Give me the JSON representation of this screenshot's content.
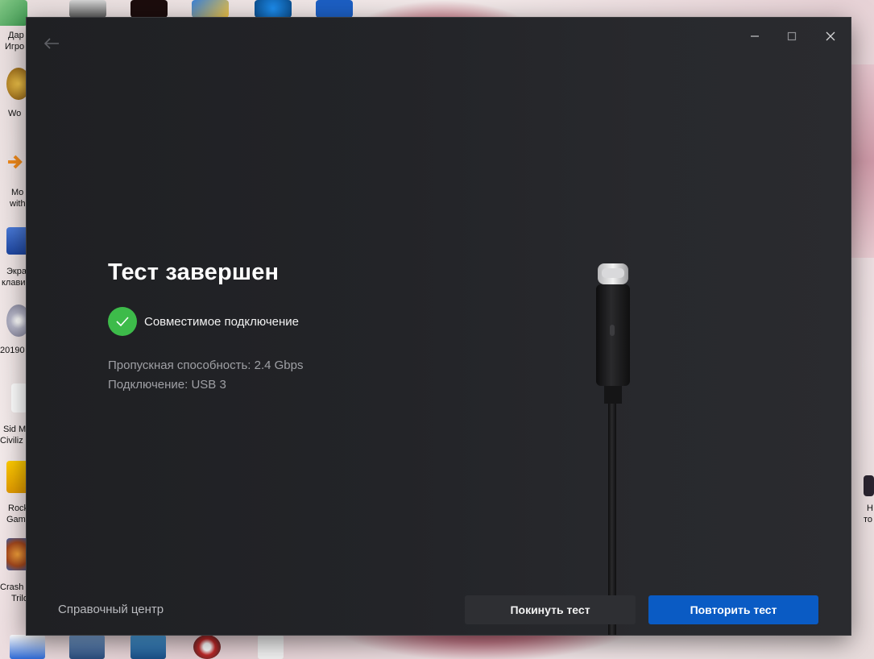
{
  "window": {
    "title": "Тест завершен",
    "status": "Совместимое подключение",
    "throughput": "Пропускная способность: 2.4 Gbps",
    "connection": "Подключение: USB 3",
    "help_link": "Справочный центр",
    "leave_button": "Покинуть тест",
    "retry_button": "Повторить тест"
  },
  "desktop": {
    "labels": [
      "Дар",
      "Игро",
      "Wo",
      "Mo",
      "with",
      "Экра",
      "клави",
      "20190",
      "Sid M",
      "Civiliz",
      "Rock",
      "Gam",
      "Crash",
      "Trilo",
      "Н",
      "то"
    ]
  },
  "colors": {
    "accent": "#0a5bc4",
    "success": "#3dbb4a",
    "window_bg": "#232428"
  },
  "icons": {
    "back": "arrow-left-icon",
    "minimize": "minimize-icon",
    "maximize": "maximize-icon",
    "close": "close-icon",
    "check": "checkmark-icon",
    "cable": "usb-c-cable-icon"
  }
}
